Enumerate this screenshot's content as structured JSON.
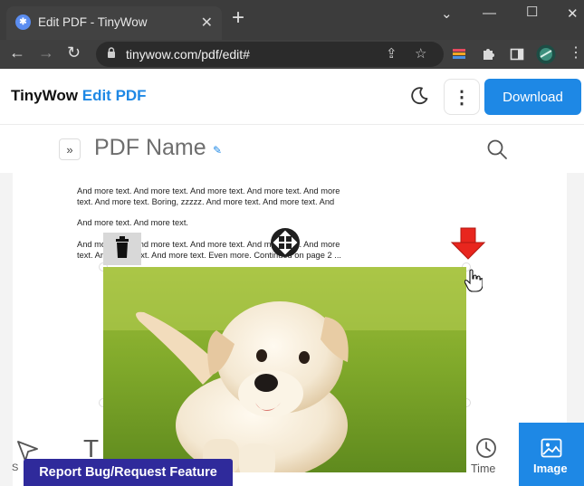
{
  "browser": {
    "tab_title": "Edit PDF - TinyWow",
    "url": "tinywow.com/pdf/edit#"
  },
  "header": {
    "brand_main": "TinyWow",
    "brand_accent": "Edit PDF",
    "download_label": "Download",
    "accent_color": "#1e88e5"
  },
  "subheader": {
    "pdf_name": "PDF Name"
  },
  "pdf": {
    "lines": [
      "And more text. And more text. And more text. And more text. And more",
      "text. And more text. Boring, zzzzz. And more text. And more text. And",
      "And more text. And more text.",
      "And more text. And more text. And more text. And more text. And more",
      "text. And more text. And more text. Even more. Continued on page 2 ..."
    ]
  },
  "tools": {
    "select_label": "S",
    "text_glyph": "T",
    "time_label": "Time",
    "image_label": "Image"
  },
  "report_label": "Report Bug/Request Feature"
}
